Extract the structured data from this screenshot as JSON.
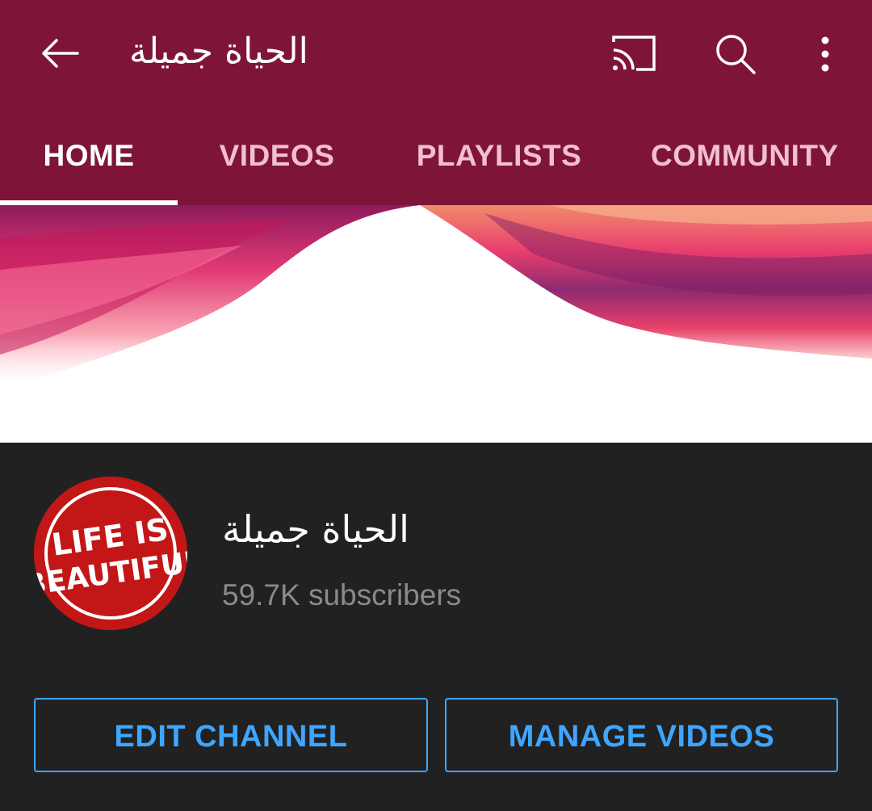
{
  "colors": {
    "header_bg": "#7e1539",
    "tab_inactive": "#f2bfd2",
    "tab_active": "#ffffff",
    "page_bg": "#212121",
    "button_accent": "#3ea6ff",
    "avatar_red": "#c31616"
  },
  "header": {
    "title": "الحياة جميلة",
    "icons": [
      "back-arrow-icon",
      "cast-icon",
      "search-icon",
      "more-vert-icon"
    ]
  },
  "tabs": [
    {
      "label": "HOME",
      "active": true
    },
    {
      "label": "VIDEOS",
      "active": false
    },
    {
      "label": "PLAYLISTS",
      "active": false
    },
    {
      "label": "COMMUNITY",
      "active": false
    }
  ],
  "channel": {
    "name": "الحياة جميلة",
    "subscribers": "59.7K subscribers",
    "avatar_line1": "LIFE IS",
    "avatar_line2": "BEAUTIFUL"
  },
  "actions": {
    "edit_label": "EDIT CHANNEL",
    "manage_label": "MANAGE VIDEOS"
  }
}
